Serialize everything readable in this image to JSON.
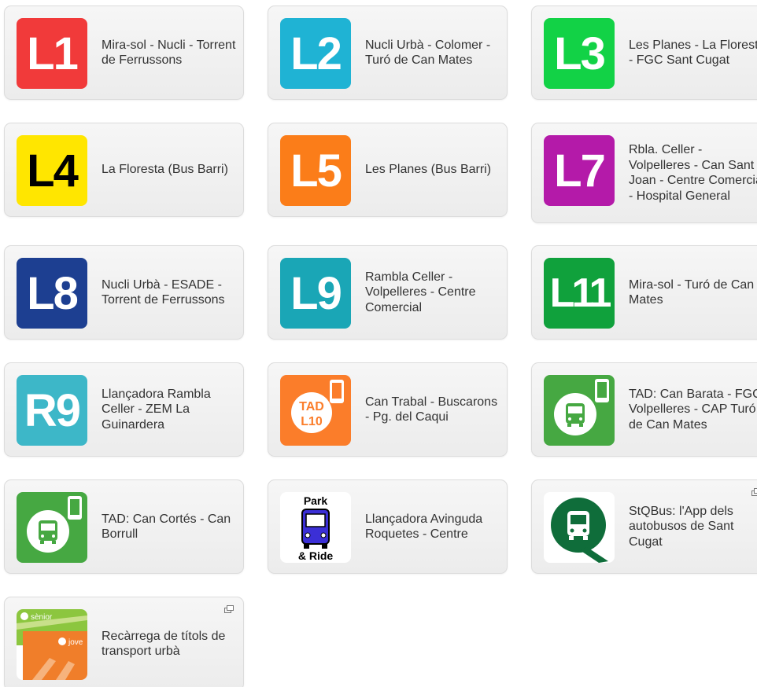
{
  "cards": [
    {
      "code": "L1",
      "label": "Mira-sol - Nucli - Torrent de Ferrussons",
      "color": "#f13a3a"
    },
    {
      "code": "L2",
      "label": "Nucli Urbà - Colomer - Turó de Can Mates",
      "color": "#1fb3d4"
    },
    {
      "code": "L3",
      "label": "Les Planes - La Floresta - FGC Sant Cugat",
      "color": "#12d246"
    },
    {
      "code": "L4",
      "label": "La Floresta (Bus Barri)",
      "color": "#ffe600"
    },
    {
      "code": "L5",
      "label": "Les Planes (Bus Barri)",
      "color": "#fb7d19"
    },
    {
      "code": "L7",
      "label": "Rbla. Celler - Volpelleres - Can Sant Joan - Centre Comercial - Hospital General",
      "color": "#b41aa9"
    },
    {
      "code": "L8",
      "label": "Nucli Urbà - ESADE - Torrent de Ferrussons",
      "color": "#1d3f91"
    },
    {
      "code": "L9",
      "label": "Rambla Celler - Volpelleres - Centre Comercial",
      "color": "#1aa6b6"
    },
    {
      "code": "L11",
      "label": "Mira-sol - Turó de Can Mates",
      "color": "#10a13c"
    },
    {
      "code": "R9",
      "label": "Llançadora Rambla Celler - ZEM La Guinardera",
      "color": "#3db7c8"
    },
    {
      "code": "TAD L10",
      "label": "Can Trabal - Buscarons - Pg. del Caqui",
      "color": "#fb7d2a"
    },
    {
      "code": "",
      "label": "TAD: Can Barata - FGC Volpelleres - CAP Turó de Can Mates",
      "color": "#46a842"
    },
    {
      "code": "",
      "label": "TAD: Can Cortés - Can Borrull",
      "color": "#46a842"
    },
    {
      "code": "",
      "label": "Llançadora Avinguda Roquetes - Centre",
      "color": "#ffffff",
      "top_text": "Park",
      "bottom_text": "& Ride"
    },
    {
      "code": "",
      "label": "StQBus: l'App dels autobusos de Sant Cugat",
      "color": "#0f6d3a"
    },
    {
      "code": "",
      "label": "Recàrrega de títols de transport urbà",
      "color": "#f07e2a",
      "top_text": "sènior",
      "bottom_text": "jove"
    }
  ]
}
